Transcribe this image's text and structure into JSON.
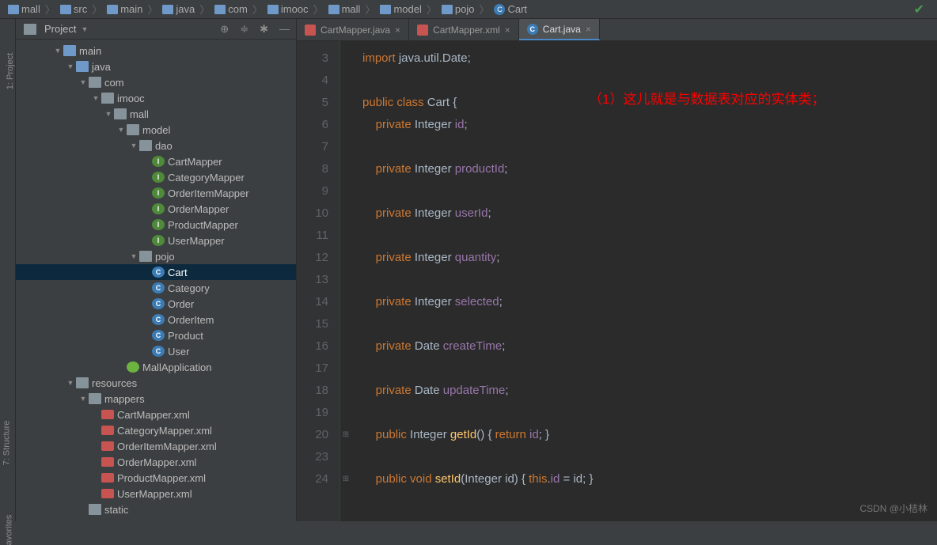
{
  "breadcrumb": [
    {
      "icon": "folder-blue",
      "label": "mall"
    },
    {
      "icon": "folder-blue",
      "label": "src"
    },
    {
      "icon": "folder-blue",
      "label": "main"
    },
    {
      "icon": "folder-blue",
      "label": "java"
    },
    {
      "icon": "folder-blue",
      "label": "com"
    },
    {
      "icon": "folder-blue",
      "label": "imooc"
    },
    {
      "icon": "folder-blue",
      "label": "mall"
    },
    {
      "icon": "folder-blue",
      "label": "model"
    },
    {
      "icon": "folder-blue",
      "label": "pojo"
    },
    {
      "icon": "class",
      "label": "Cart"
    }
  ],
  "panel": {
    "title": "Project"
  },
  "left_strip": {
    "project": "1: Project",
    "structure": "7: Structure",
    "favorites": "avorites"
  },
  "tree": [
    {
      "indent": 3,
      "arrow": "▼",
      "icon": "folder-blue",
      "label": "main"
    },
    {
      "indent": 4,
      "arrow": "▼",
      "icon": "folder-blue",
      "label": "java"
    },
    {
      "indent": 5,
      "arrow": "▼",
      "icon": "folder",
      "label": "com"
    },
    {
      "indent": 6,
      "arrow": "▼",
      "icon": "folder",
      "label": "imooc"
    },
    {
      "indent": 7,
      "arrow": "▼",
      "icon": "folder",
      "label": "mall"
    },
    {
      "indent": 8,
      "arrow": "▼",
      "icon": "folder",
      "label": "model"
    },
    {
      "indent": 9,
      "arrow": "▼",
      "icon": "folder",
      "label": "dao"
    },
    {
      "indent": 10,
      "arrow": "",
      "icon": "interface",
      "label": "CartMapper"
    },
    {
      "indent": 10,
      "arrow": "",
      "icon": "interface",
      "label": "CategoryMapper"
    },
    {
      "indent": 10,
      "arrow": "",
      "icon": "interface",
      "label": "OrderItemMapper"
    },
    {
      "indent": 10,
      "arrow": "",
      "icon": "interface",
      "label": "OrderMapper"
    },
    {
      "indent": 10,
      "arrow": "",
      "icon": "interface",
      "label": "ProductMapper"
    },
    {
      "indent": 10,
      "arrow": "",
      "icon": "interface",
      "label": "UserMapper"
    },
    {
      "indent": 9,
      "arrow": "▼",
      "icon": "folder",
      "label": "pojo"
    },
    {
      "indent": 10,
      "arrow": "",
      "icon": "class",
      "label": "Cart",
      "selected": true
    },
    {
      "indent": 10,
      "arrow": "",
      "icon": "class",
      "label": "Category"
    },
    {
      "indent": 10,
      "arrow": "",
      "icon": "class",
      "label": "Order"
    },
    {
      "indent": 10,
      "arrow": "",
      "icon": "class",
      "label": "OrderItem"
    },
    {
      "indent": 10,
      "arrow": "",
      "icon": "class",
      "label": "Product"
    },
    {
      "indent": 10,
      "arrow": "",
      "icon": "class",
      "label": "User"
    },
    {
      "indent": 8,
      "arrow": "",
      "icon": "spring",
      "label": "MallApplication"
    },
    {
      "indent": 4,
      "arrow": "▼",
      "icon": "folder",
      "label": "resources"
    },
    {
      "indent": 5,
      "arrow": "▼",
      "icon": "folder",
      "label": "mappers"
    },
    {
      "indent": 6,
      "arrow": "",
      "icon": "xml",
      "label": "CartMapper.xml"
    },
    {
      "indent": 6,
      "arrow": "",
      "icon": "xml",
      "label": "CategoryMapper.xml"
    },
    {
      "indent": 6,
      "arrow": "",
      "icon": "xml",
      "label": "OrderItemMapper.xml"
    },
    {
      "indent": 6,
      "arrow": "",
      "icon": "xml",
      "label": "OrderMapper.xml"
    },
    {
      "indent": 6,
      "arrow": "",
      "icon": "xml",
      "label": "ProductMapper.xml"
    },
    {
      "indent": 6,
      "arrow": "",
      "icon": "xml",
      "label": "UserMapper.xml"
    },
    {
      "indent": 5,
      "arrow": "",
      "icon": "folder",
      "label": "static"
    }
  ],
  "tabs": [
    {
      "icon": "j",
      "label": "CartMapper.java",
      "active": false
    },
    {
      "icon": "j",
      "label": "CartMapper.xml",
      "active": false
    },
    {
      "icon": "c",
      "label": "Cart.java",
      "active": true
    }
  ],
  "annotation": "（1）这儿就是与数据表对应的实体类；",
  "watermark": "CSDN @小桔林",
  "code": {
    "lines": [
      {
        "n": 3,
        "tokens": [
          [
            "kw",
            "import "
          ],
          [
            "type",
            "java.util.Date"
          ],
          [
            "punct",
            ";"
          ]
        ]
      },
      {
        "n": 4,
        "tokens": []
      },
      {
        "n": 5,
        "tokens": [
          [
            "kw",
            "public class "
          ],
          [
            "ident",
            "Cart "
          ],
          [
            "punct",
            "{"
          ]
        ],
        "cursor_after": 2
      },
      {
        "n": 6,
        "tokens": [
          [
            "",
            "    "
          ],
          [
            "kw",
            "private "
          ],
          [
            "type",
            "Integer "
          ],
          [
            "field",
            "id"
          ],
          [
            "punct",
            ";"
          ]
        ]
      },
      {
        "n": 7,
        "tokens": []
      },
      {
        "n": 8,
        "tokens": [
          [
            "",
            "    "
          ],
          [
            "kw",
            "private "
          ],
          [
            "type",
            "Integer "
          ],
          [
            "field",
            "productId"
          ],
          [
            "punct",
            ";"
          ]
        ]
      },
      {
        "n": 9,
        "tokens": []
      },
      {
        "n": 10,
        "tokens": [
          [
            "",
            "    "
          ],
          [
            "kw",
            "private "
          ],
          [
            "type",
            "Integer "
          ],
          [
            "field",
            "userId"
          ],
          [
            "punct",
            ";"
          ]
        ]
      },
      {
        "n": 11,
        "tokens": []
      },
      {
        "n": 12,
        "tokens": [
          [
            "",
            "    "
          ],
          [
            "kw",
            "private "
          ],
          [
            "type",
            "Integer "
          ],
          [
            "field",
            "quantity"
          ],
          [
            "punct",
            ";"
          ]
        ]
      },
      {
        "n": 13,
        "tokens": []
      },
      {
        "n": 14,
        "tokens": [
          [
            "",
            "    "
          ],
          [
            "kw",
            "private "
          ],
          [
            "type",
            "Integer "
          ],
          [
            "field",
            "selected"
          ],
          [
            "punct",
            ";"
          ]
        ]
      },
      {
        "n": 15,
        "tokens": []
      },
      {
        "n": 16,
        "tokens": [
          [
            "",
            "    "
          ],
          [
            "kw",
            "private "
          ],
          [
            "type",
            "Date "
          ],
          [
            "field",
            "createTime"
          ],
          [
            "punct",
            ";"
          ]
        ]
      },
      {
        "n": 17,
        "tokens": []
      },
      {
        "n": 18,
        "tokens": [
          [
            "",
            "    "
          ],
          [
            "kw",
            "private "
          ],
          [
            "type",
            "Date "
          ],
          [
            "field",
            "updateTime"
          ],
          [
            "punct",
            ";"
          ]
        ]
      },
      {
        "n": 19,
        "tokens": []
      },
      {
        "n": 20,
        "tokens": [
          [
            "",
            "    "
          ],
          [
            "kw",
            "public "
          ],
          [
            "type",
            "Integer "
          ],
          [
            "method",
            "getId"
          ],
          [
            "punct",
            "() { "
          ],
          [
            "kw",
            "return "
          ],
          [
            "field",
            "id"
          ],
          [
            "punct",
            "; }"
          ]
        ],
        "fold": "⊞"
      },
      {
        "n": 23,
        "tokens": []
      },
      {
        "n": 24,
        "tokens": [
          [
            "",
            "    "
          ],
          [
            "kw",
            "public void "
          ],
          [
            "method",
            "setId"
          ],
          [
            "punct",
            "(Integer id) { "
          ],
          [
            "kw",
            "this"
          ],
          [
            "punct",
            "."
          ],
          [
            "field",
            "id"
          ],
          [
            "punct",
            " = id; }"
          ]
        ],
        "fold": "⊞"
      }
    ]
  }
}
